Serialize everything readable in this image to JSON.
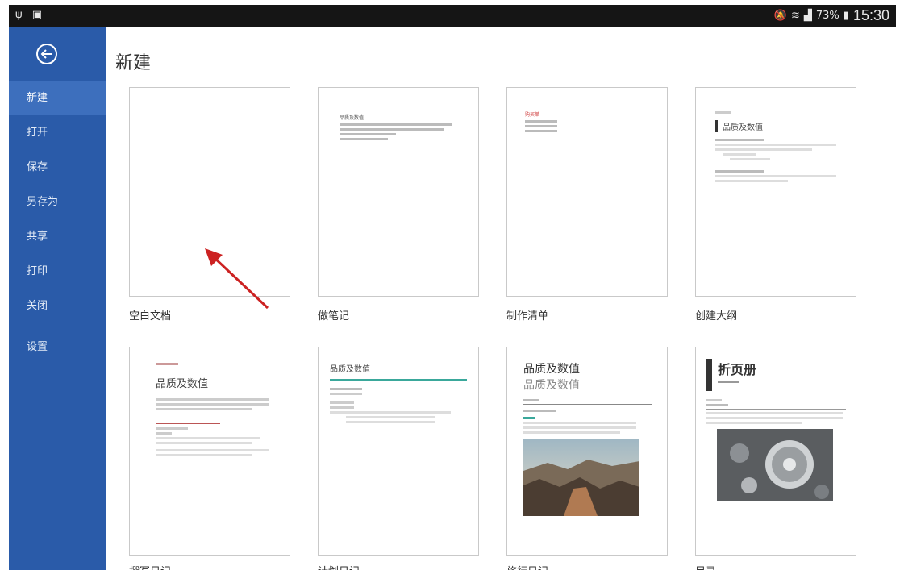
{
  "statusbar": {
    "left_icons": "ψ ▣",
    "battery": "73%",
    "time": "15:30"
  },
  "sidebar": {
    "back_icon": "back-circle-icon",
    "items": [
      {
        "label": "新建",
        "active": true
      },
      {
        "label": "打开"
      },
      {
        "label": "保存"
      },
      {
        "label": "另存为"
      },
      {
        "label": "共享"
      },
      {
        "label": "打印"
      },
      {
        "label": "关闭"
      },
      {
        "label": "设置"
      }
    ]
  },
  "main": {
    "title": "新建",
    "templates": [
      {
        "label": "空白文档"
      },
      {
        "label": "做笔记",
        "heading": "品质及数值"
      },
      {
        "label": "制作清单",
        "heading": "购买单"
      },
      {
        "label": "创建大纲",
        "heading": "品质及数值"
      },
      {
        "label": "撰写日记",
        "heading": "品质及数值"
      },
      {
        "label": "计划日记",
        "heading": "品质及数值"
      },
      {
        "label": "旅行日记",
        "heading": "品质及数值",
        "subheading": "品质及数值"
      },
      {
        "label": "目录",
        "heading": "折页册"
      }
    ]
  },
  "colors": {
    "sidebar": "#2a5ba9",
    "active": "#3d6fbd",
    "arrow": "#cc2222",
    "teal": "#3aa89b"
  }
}
